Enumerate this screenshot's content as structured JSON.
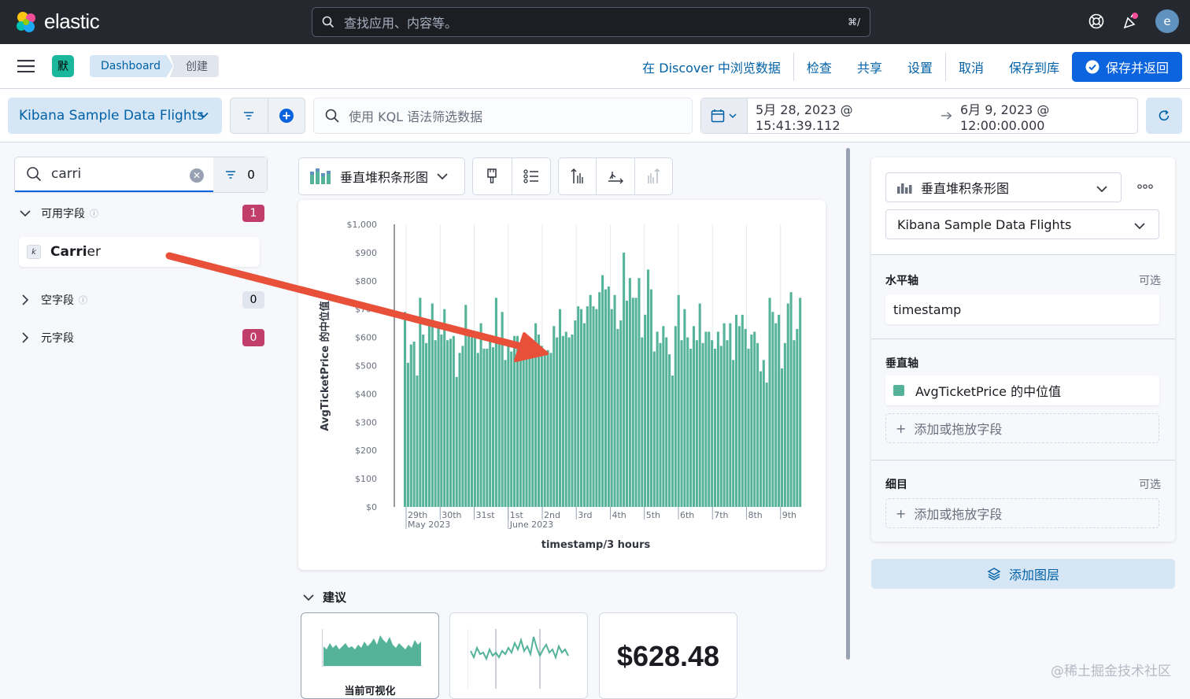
{
  "header": {
    "brand": "elastic",
    "search_placeholder": "查找应用、内容等。",
    "search_shortcut": "⌘/",
    "avatar_initial": "e"
  },
  "nav": {
    "space_badge": "默",
    "breadcrumbs": [
      "Dashboard",
      "创建"
    ],
    "links": [
      "在 Discover 中浏览数据",
      "检查",
      "共享",
      "设置",
      "取消",
      "保存到库"
    ],
    "save_return": "保存并返回"
  },
  "query": {
    "data_view": "Kibana Sample Data Flights",
    "kql_placeholder": "使用 KQL 语法筛选数据",
    "date_start": "5月 28, 2023 @ 15:41:39.112",
    "date_end": "6月 9, 2023 @ 12:00:00.000"
  },
  "fields_panel": {
    "search_value": "carri",
    "filter_count": "0",
    "groups": [
      {
        "label": "可用字段",
        "count": "1"
      },
      {
        "label": "空字段",
        "count": "0"
      },
      {
        "label": "元字段",
        "count": "0"
      }
    ],
    "field_type": "k",
    "field_match": "Carri",
    "field_rest": "er"
  },
  "workspace": {
    "chart_type_label": "垂直堆积条形图",
    "suggestions_label": "建议",
    "suggestion_current": "当前可视化",
    "suggestion_metric": "$628.48"
  },
  "config": {
    "chart_type_label": "垂直堆积条形图",
    "data_view": "Kibana Sample Data Flights",
    "x_axis_label": "水平轴",
    "x_axis_optional": "可选",
    "x_axis_value": "timestamp",
    "y_axis_label": "垂直轴",
    "y_axis_value": "AvgTicketPrice 的中位值",
    "add_field": "添加或拖放字段",
    "breakdown_label": "细目",
    "breakdown_optional": "可选",
    "add_layer": "添加图层"
  },
  "watermark": "@稀土掘金技术社区",
  "colors": {
    "bar": "#54b399",
    "accent": "#0b64dd",
    "annotation_arrow": "#e8503a"
  },
  "chart_data": {
    "type": "bar",
    "title": "",
    "xlabel": "timestamp/3 hours",
    "ylabel": "AvgTicketPrice 的中位值",
    "ylim": [
      0,
      1000
    ],
    "y_ticks": [
      "$1,000",
      "$900",
      "$800",
      "$700",
      "$600",
      "$500",
      "$400",
      "$300",
      "$200",
      "$100",
      "$0"
    ],
    "x_ticks": [
      "29th",
      "30th",
      "31st",
      "1st",
      "2nd",
      "3rd",
      "4th",
      "5th",
      "6th",
      "7th",
      "8th",
      "9th"
    ],
    "x_tick_sublabels": {
      "29th": "May 2023",
      "1st": "June 2023"
    },
    "values": [
      690,
      510,
      575,
      585,
      465,
      740,
      610,
      580,
      660,
      720,
      590,
      655,
      610,
      700,
      590,
      595,
      605,
      460,
      545,
      570,
      715,
      620,
      600,
      605,
      545,
      650,
      560,
      560,
      600,
      565,
      740,
      585,
      690,
      520,
      590,
      550,
      605,
      605,
      570,
      555,
      550,
      575,
      565,
      650,
      610,
      570,
      545,
      555,
      545,
      640,
      600,
      700,
      605,
      620,
      600,
      610,
      660,
      710,
      700,
      650,
      710,
      750,
      710,
      700,
      760,
      820,
      770,
      780,
      700,
      750,
      630,
      660,
      900,
      730,
      810,
      740,
      740,
      810,
      600,
      680,
      840,
      770,
      550,
      620,
      580,
      640,
      600,
      540,
      465,
      640,
      750,
      590,
      700,
      600,
      560,
      640,
      590,
      720,
      580,
      620,
      620,
      590,
      560,
      620,
      570,
      650,
      590,
      650,
      520,
      680,
      640,
      680,
      630,
      560,
      610,
      620,
      580,
      480,
      520,
      440,
      740,
      690,
      650,
      680,
      490,
      580,
      720,
      760,
      590,
      630,
      740
    ]
  }
}
